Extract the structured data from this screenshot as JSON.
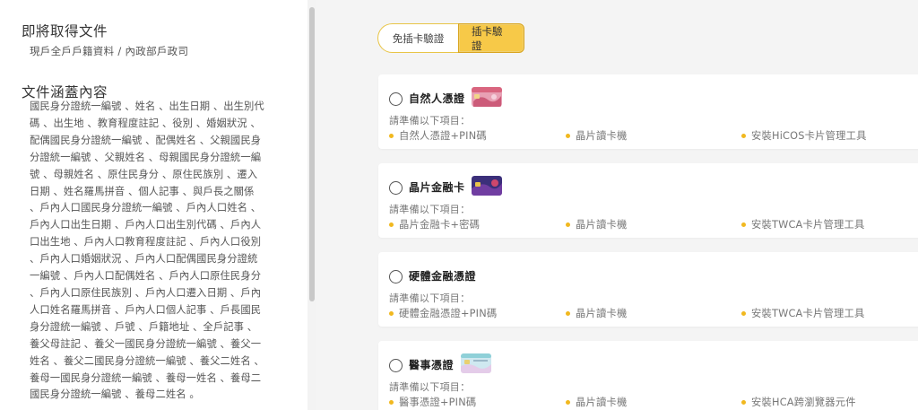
{
  "document": {
    "title": "即將取得文件",
    "subtitle": "現戶全戶戶籍資料 / 內政部戶政司"
  },
  "contents": {
    "title": "文件涵蓋內容",
    "body": "國民身分證統一編號 、姓名 、出生日期 、出生別代碼 、出生地 、教育程度註記 、役別 、婚姻狀況 、配偶國民身分證統一編號 、配偶姓名 、父親國民身分證統一編號 、父親姓名 、母親國民身分證統一編號 、母親姓名 、原住民身分 、原住民族別 、遷入日期 、姓名羅馬拼音 、個人記事 、與戶長之關係 、戶內人口國民身分證統一編號 、戶內人口姓名 、戶內人口出生日期 、戶內人口出生別代碼 、戶內人口出生地 、戶內人口教育程度註記 、戶內人口役別 、戶內人口婚姻狀況 、戶內人口配偶國民身分證統一編號 、戶內人口配偶姓名 、戶內人口原住民身分 、戶內人口原住民族別 、戶內人口遷入日期 、戶內人口姓名羅馬拼音 、戶內人口個人記事 、戶長國民身分證統一編號 、戶號 、戶籍地址 、全戶記事 、養父母註記 、養父一國民身分證統一編號 、養父一姓名 、養父二國民身分證統一編號 、養父二姓名 、養母一國民身分證統一編號 、養母一姓名 、養母二國民身分證統一編號 、養母二姓名 。"
  },
  "tabs": {
    "no_card": "免插卡驗證",
    "with_card": "插卡驗證"
  },
  "cards": [
    {
      "title": "自然人憑證",
      "prep": "請準備以下項目：",
      "items": [
        "自然人憑證+PIN碼",
        "晶片讀卡機",
        "安裝HiCOS卡片管理工具"
      ]
    },
    {
      "title": "晶片金融卡",
      "prep": "請準備以下項目：",
      "items": [
        "晶片金融卡+密碼",
        "晶片讀卡機",
        "安裝TWCA卡片管理工具"
      ]
    },
    {
      "title": "硬體金融憑證",
      "prep": "請準備以下項目：",
      "items": [
        "硬體金融憑證+PIN碼",
        "晶片讀卡機",
        "安裝TWCA卡片管理工具"
      ]
    },
    {
      "title": "醫事憑證",
      "prep": "請準備以下項目：",
      "items": [
        "醫事憑證+PIN碼",
        "晶片讀卡機",
        "安裝HCA跨瀏覽器元件"
      ]
    }
  ],
  "colors": {
    "accent": "#f7c948",
    "bullet": "#f1b81f"
  }
}
